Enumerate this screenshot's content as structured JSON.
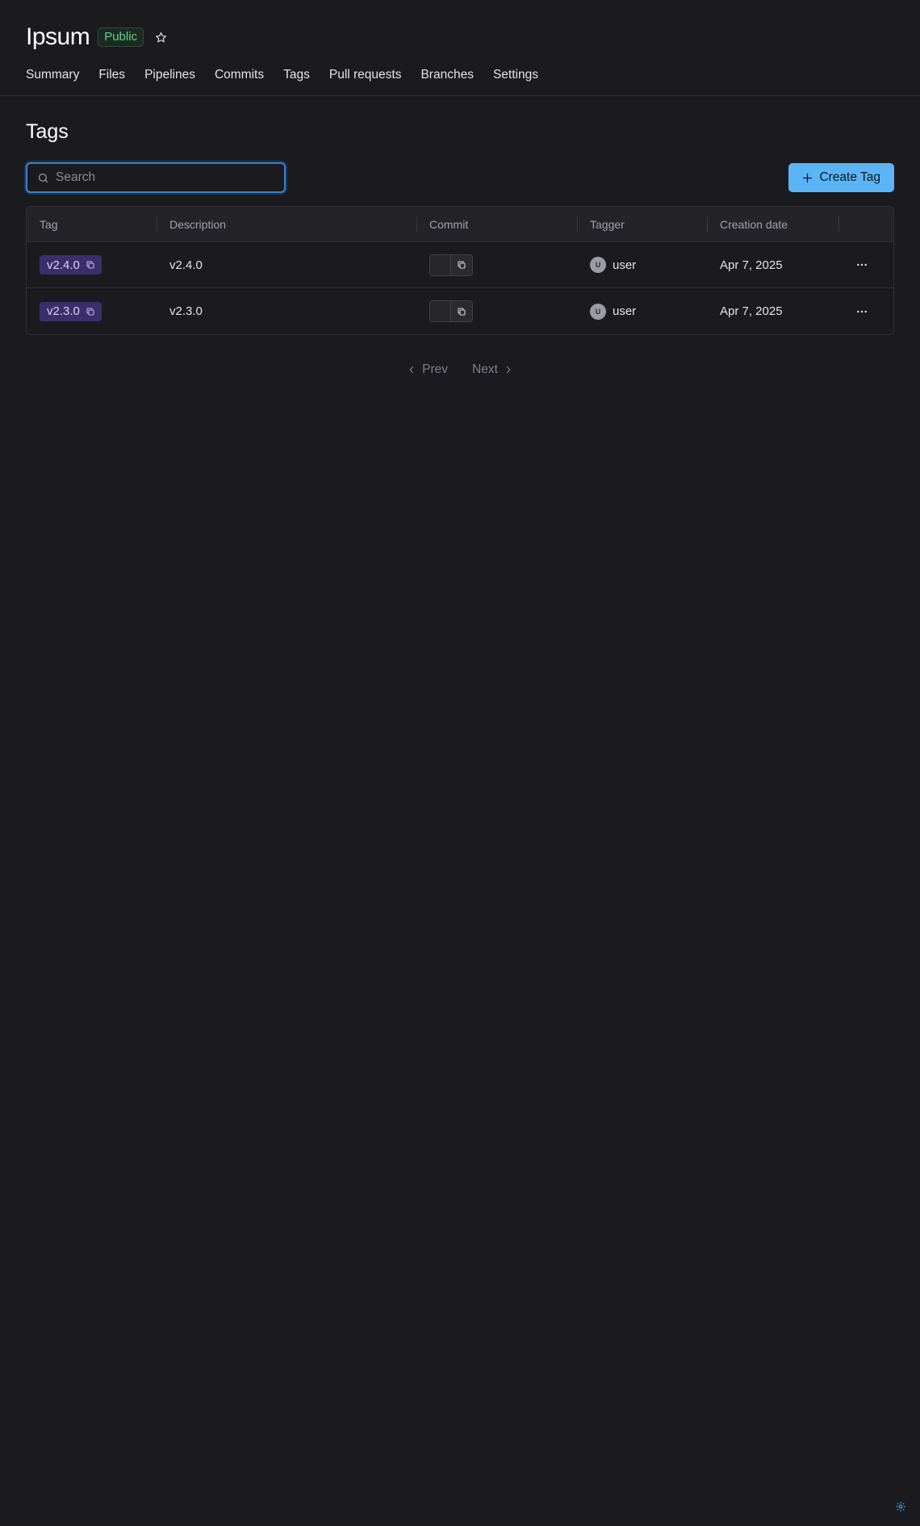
{
  "repo": {
    "name": "Ipsum",
    "visibility": "Public"
  },
  "nav": [
    "Summary",
    "Files",
    "Pipelines",
    "Commits",
    "Tags",
    "Pull requests",
    "Branches",
    "Settings"
  ],
  "page": {
    "title": "Tags",
    "search_placeholder": "Search",
    "search_value": "",
    "create_label": "Create Tag"
  },
  "table": {
    "headers": [
      "Tag",
      "Description",
      "Commit",
      "Tagger",
      "Creation date"
    ],
    "rows": [
      {
        "tag": "v2.4.0",
        "description": "v2.4.0",
        "commit": "",
        "tagger_initial": "U",
        "tagger": "user",
        "date": "Apr 7, 2025"
      },
      {
        "tag": "v2.3.0",
        "description": "v2.3.0",
        "commit": "",
        "tagger_initial": "U",
        "tagger": "user",
        "date": "Apr 7, 2025"
      }
    ]
  },
  "pagination": {
    "prev": "Prev",
    "next": "Next"
  },
  "colors": {
    "background": "#1b1b1f",
    "accent": "#5ab4f5",
    "public_badge": "#5fd38d",
    "tag_pill": "#3a2f6b"
  },
  "icons": [
    "star-icon",
    "search-icon",
    "plus-icon",
    "copy-icon",
    "more-icon",
    "chevron-left-icon",
    "chevron-right-icon",
    "gear-icon"
  ]
}
